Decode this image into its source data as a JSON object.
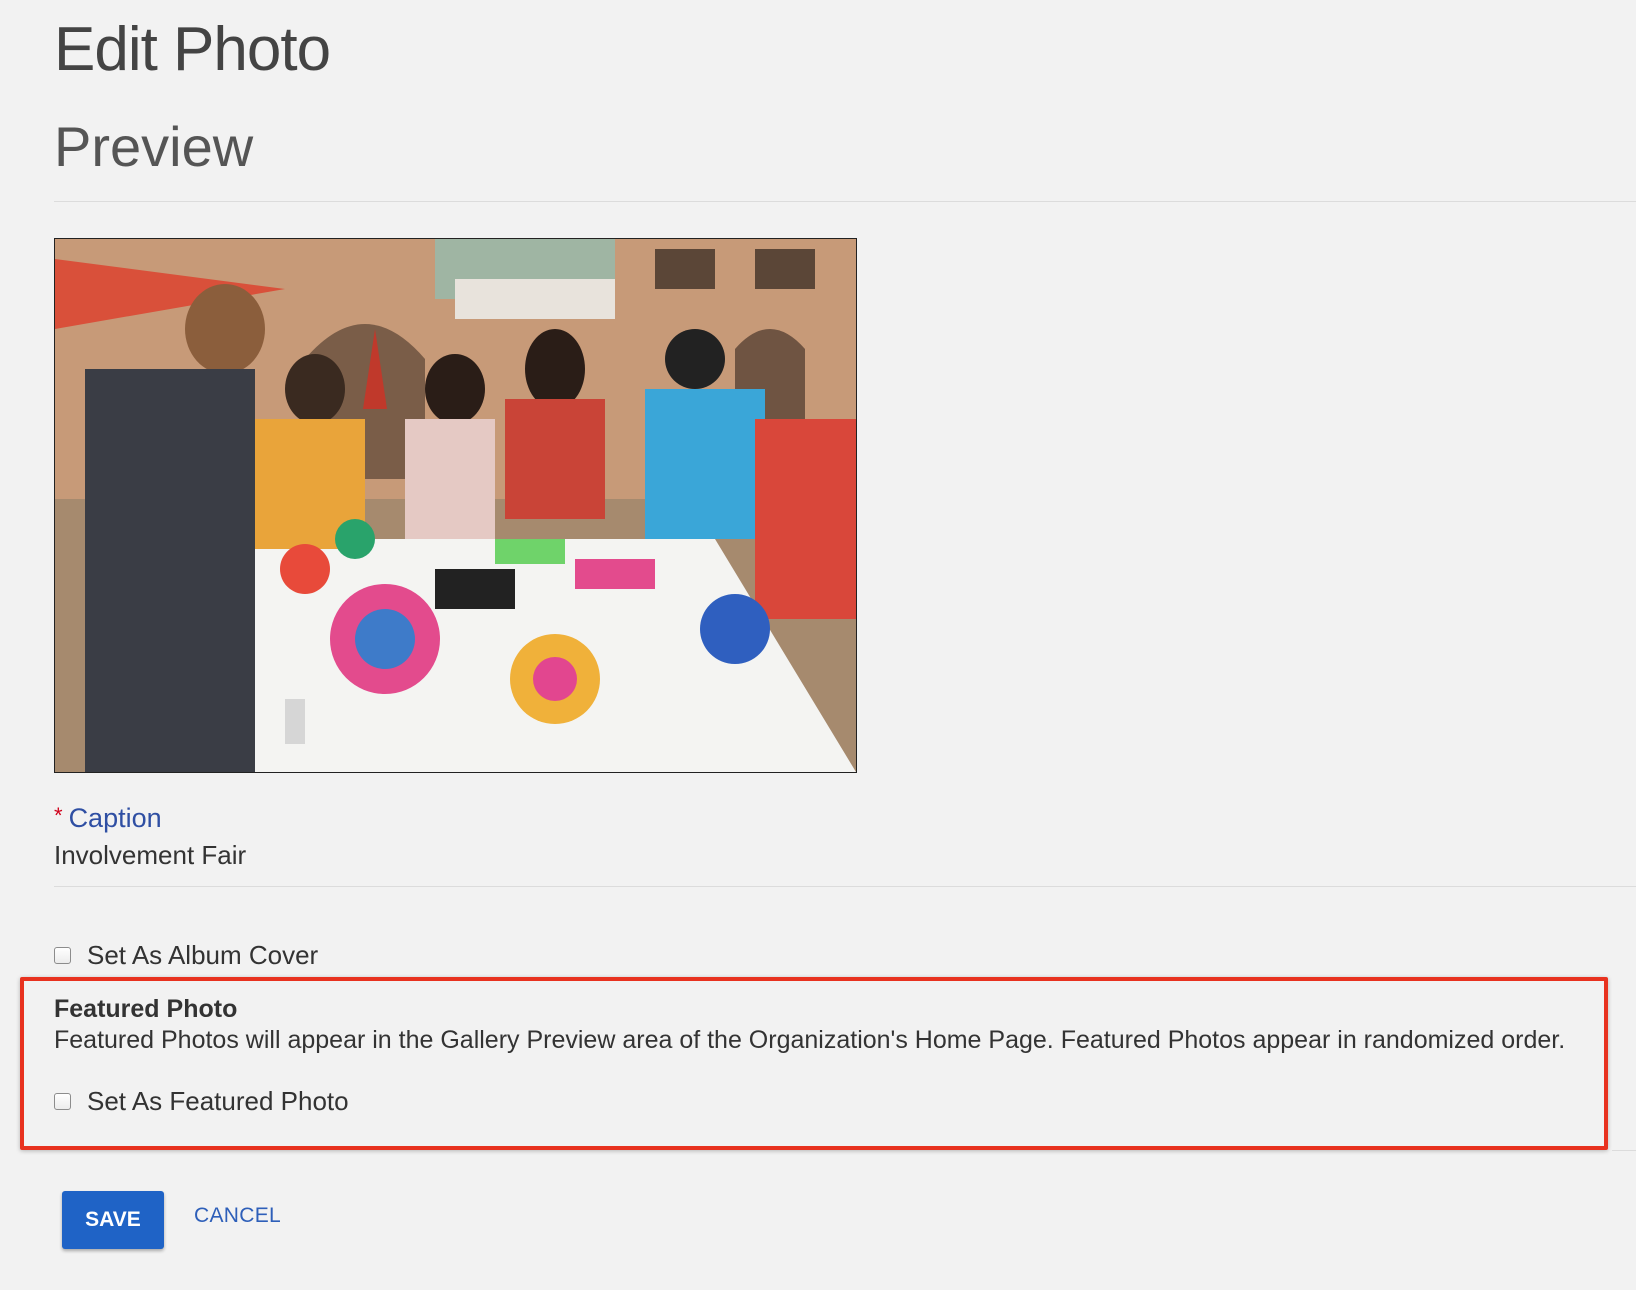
{
  "page": {
    "title": "Edit Photo"
  },
  "preview": {
    "heading": "Preview"
  },
  "caption": {
    "required_marker": "*",
    "label": "Caption",
    "value": "Involvement Fair"
  },
  "album_cover": {
    "label": "Set As Album Cover",
    "checked": false
  },
  "featured": {
    "heading": "Featured Photo",
    "description": "Featured Photos will appear in the Gallery Preview area of the Organization's Home Page. Featured Photos appear in randomized order.",
    "checkbox_label": "Set As Featured Photo",
    "checked": false,
    "highlight_color": "#e8321f"
  },
  "actions": {
    "save_label": "SAVE",
    "cancel_label": "CANCEL"
  },
  "colors": {
    "primary": "#1f63c6",
    "link": "#2f4fa3",
    "required": "#d0021b",
    "background": "#f2f2f2"
  }
}
